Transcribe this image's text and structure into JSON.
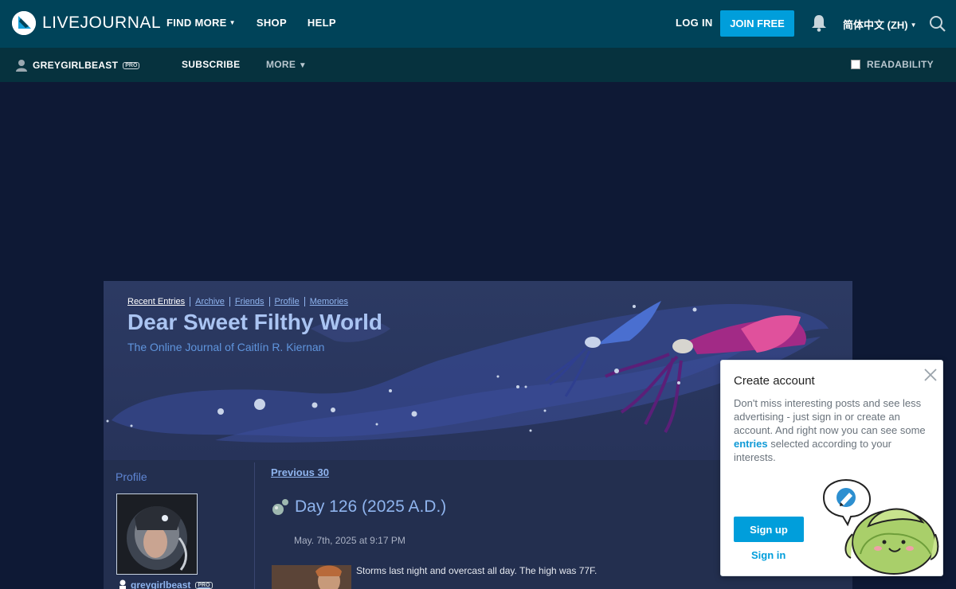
{
  "topbar": {
    "logo_text": "LIVEJOURNAL",
    "nav": [
      {
        "label": "FIND MORE",
        "has_caret": true
      },
      {
        "label": "SHOP"
      },
      {
        "label": "HELP"
      }
    ],
    "login_label": "LOG IN",
    "join_label": "JOIN FREE",
    "language": "简体中文 (ZH)",
    "bg_color": "#004359",
    "accent_color": "#009edb"
  },
  "subbar": {
    "username": "GREYGIRLBEAST",
    "pro_badge": "PRO",
    "subscribe_label": "SUBSCRIBE",
    "more_label": "MORE",
    "readability_label": "READABILITY"
  },
  "journal": {
    "nav_links": [
      "Recent Entries",
      "Archive",
      "Friends",
      "Profile",
      "Memories"
    ],
    "title": "Dear Sweet Filthy World",
    "subtitle": "The Online Journal of Caitlín R. Kiernan",
    "sidebar_title": "Profile",
    "sidebar_username": "greygirlbeast",
    "sidebar_pro": "PRO",
    "previous_label": "Previous 30",
    "entry": {
      "title": "Day 126 (2025 A.D.)",
      "date": "May. 7th, 2025 at 9:17 PM",
      "text": "Storms last night and overcast all day. The high was 77F."
    }
  },
  "popup": {
    "title": "Create account",
    "text_before": "Don't miss interesting posts and see less advertising - just sign in or create an account. And right now you can see some ",
    "text_link": "entries",
    "text_after": " selected according to your interests.",
    "signup_label": "Sign up",
    "signin_label": "Sign in"
  }
}
